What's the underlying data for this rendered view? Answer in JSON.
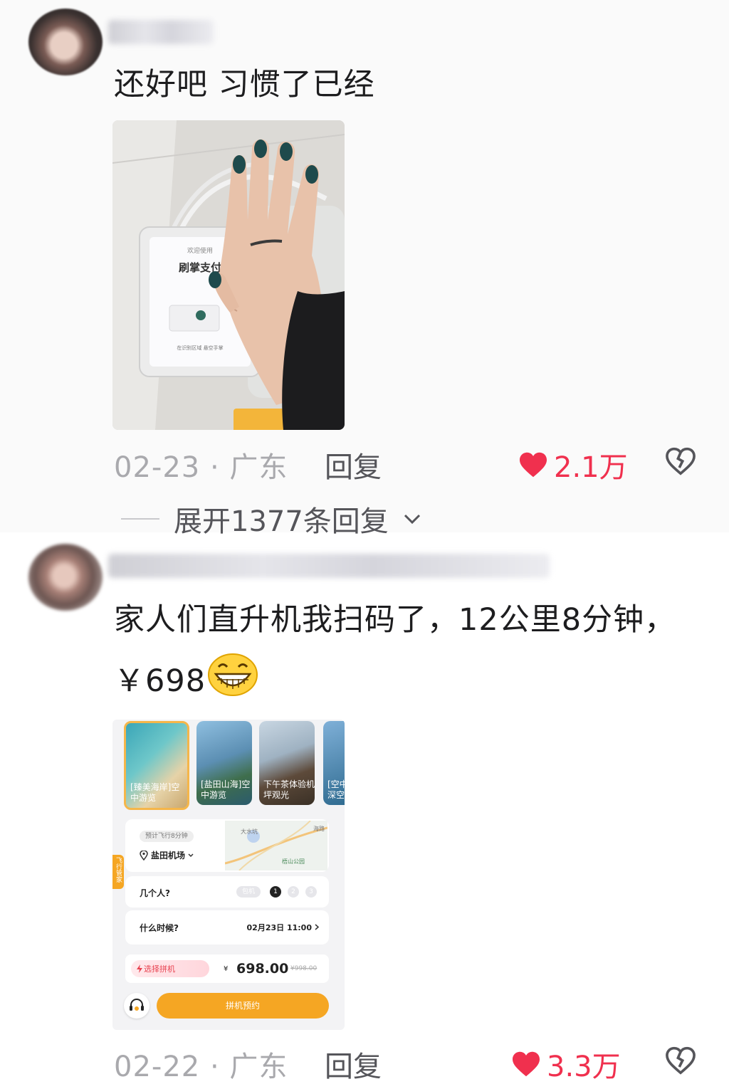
{
  "comments": [
    {
      "text": "还好吧 习惯了已经",
      "photo": {
        "device_title": "刷掌支付",
        "device_header": "欢迎使用",
        "device_hint": "在识别区域 悬空手掌"
      },
      "meta": "02-23 · 广东",
      "reply_label": "回复",
      "likes": "2.1万",
      "expand_label": "展开1377条回复"
    },
    {
      "text": "家人们直升机我扫码了，12公里8分钟，￥698",
      "app_screenshot": {
        "tiles": [
          "[臻美海岸]空中游览",
          "[盐田山海]空中游览",
          "下午茶体验机坪观光",
          "[空中]深空"
        ],
        "badge": "预计飞行8分钟",
        "location": "盐田机场",
        "map_labels": [
          "大水坑",
          "梧山公园",
          "海路"
        ],
        "side_tab": "飞行管家",
        "people_label": "几个人?",
        "people_options": [
          "包机",
          "1",
          "2",
          "3"
        ],
        "time_label": "什么时候?",
        "time_value": "02月23日 11:00",
        "pool_label": "选择拼机",
        "price_symbol": "¥",
        "price": "698.00",
        "original_price": "¥998.00",
        "book_button": "拼机预约"
      },
      "meta": "02-22 · 广东",
      "reply_label": "回复",
      "likes": "3.3万"
    }
  ],
  "colors": {
    "like_red": "#f0304e",
    "accent_orange": "#f5a623",
    "meta_grey": "#a9a9ad"
  },
  "icons": [
    "heart-icon",
    "dislike-heart-icon",
    "chevron-down-icon",
    "grin-emoji-icon",
    "headset-icon",
    "location-pin-icon",
    "lightning-icon"
  ]
}
